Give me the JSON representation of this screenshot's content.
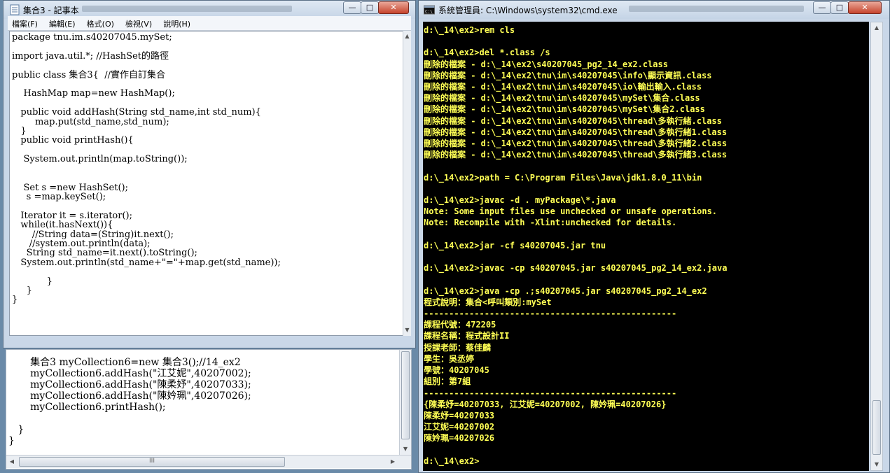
{
  "notepad": {
    "title": "集合3 - 記事本",
    "menu": [
      "檔案(F)",
      "編輯(E)",
      "格式(O)",
      "檢視(V)",
      "說明(H)"
    ],
    "code": "package tnu.im.s40207045.mySet;\n\nimport java.util.*; //HashSet的路徑\n\npublic class 集合3{  //實作自訂集合\n\n    HashMap map=new HashMap();\n\n   public void addHash(String std_name,int std_num){\n        map.put(std_name,std_num);\n   }\n   public void printHash(){\n\n    System.out.println(map.toString());\n\n\n    Set s =new HashSet();\n     s =map.keySet();\n\n   Iterator it = s.iterator();\n   while(it.hasNext()){\n       //String data=(String)it.next();\n      //system.out.println(data);\n     String std_name=it.next().toString();\n   System.out.println(std_name+\"=\"+map.get(std_name));\n\n            }\n     }\n}"
  },
  "background_editor": {
    "code": "       集合3 myCollection6=new 集合3();//14_ex2\n       myCollection6.addHash(\"江艾妮\",40207002);\n       myCollection6.addHash(\"陳柔妤\",40207033);\n       myCollection6.addHash(\"陳妗珮\",40207026);\n       myCollection6.printHash();\n\n   }\n}",
    "hscroll_thumb_label": "III"
  },
  "cmd": {
    "title": "系統管理員: C:\\Windows\\system32\\cmd.exe",
    "output": "d:\\_14\\ex2>rem cls\n\nd:\\_14\\ex2>del *.class /s\n刪除的檔案 - d:\\_14\\ex2\\s40207045_pg2_14_ex2.class\n刪除的檔案 - d:\\_14\\ex2\\tnu\\im\\s40207045\\info\\顯示資訊.class\n刪除的檔案 - d:\\_14\\ex2\\tnu\\im\\s40207045\\io\\輸出輸入.class\n刪除的檔案 - d:\\_14\\ex2\\tnu\\im\\s40207045\\mySet\\集合.class\n刪除的檔案 - d:\\_14\\ex2\\tnu\\im\\s40207045\\mySet\\集合2.class\n刪除的檔案 - d:\\_14\\ex2\\tnu\\im\\s40207045\\thread\\多執行緒.class\n刪除的檔案 - d:\\_14\\ex2\\tnu\\im\\s40207045\\thread\\多執行緒1.class\n刪除的檔案 - d:\\_14\\ex2\\tnu\\im\\s40207045\\thread\\多執行緒2.class\n刪除的檔案 - d:\\_14\\ex2\\tnu\\im\\s40207045\\thread\\多執行緒3.class\n\nd:\\_14\\ex2>path = C:\\Program Files\\Java\\jdk1.8.0_11\\bin\n\nd:\\_14\\ex2>javac -d . myPackage\\*.java\nNote: Some input files use unchecked or unsafe operations.\nNote: Recompile with -Xlint:unchecked for details.\n\nd:\\_14\\ex2>jar -cf s40207045.jar tnu\n\nd:\\_14\\ex2>javac -cp s40207045.jar s40207045_pg2_14_ex2.java\n\nd:\\_14\\ex2>java -cp .;s40207045.jar s40207045_pg2_14_ex2\n程式說明：集合<呼叫類別:mySet\n--------------------------------------------------\n課程代號：472205\n課程名稱：程式設計II\n授課老師：蔡佳麟\n學生：吳丞婷\n學號：40207045\n組別：第7組\n--------------------------------------------------\n{陳柔妤=40207033, 江艾妮=40207002, 陳妗珮=40207026}\n陳柔妤=40207033\n江艾妮=40207002\n陳妗珮=40207026\n\nd:\\_14\\ex2>"
  },
  "window_buttons": {
    "minimize": "—",
    "maximize": "□",
    "close": "✕"
  },
  "colors": {
    "console_bg": "#000000",
    "console_text": "#ffff55",
    "close_red": "#c6442d"
  }
}
